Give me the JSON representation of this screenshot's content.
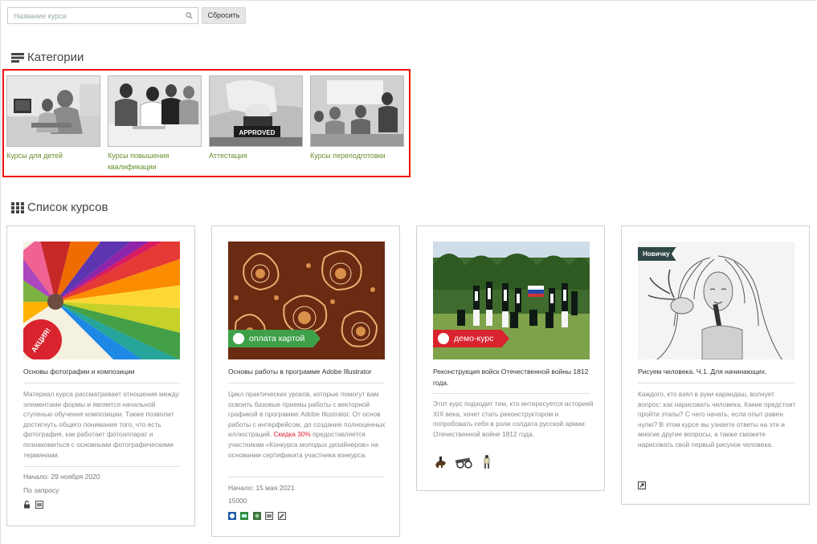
{
  "search": {
    "placeholder": "Название курса",
    "reset_label": "Сбросить"
  },
  "categories": {
    "title": "Категории",
    "items": [
      {
        "label": "Курсы для детей"
      },
      {
        "label": "Курсы повышения квалификации"
      },
      {
        "label": "Аттестация",
        "stamp": "APPROVED"
      },
      {
        "label": "Курсы переподготовки"
      }
    ]
  },
  "courses": {
    "title": "Список курсов",
    "items": [
      {
        "badge": "АКЦИЯ!",
        "title": "Основы фотографии и композиции",
        "description": "Материал курса рассматривает отношения между элементами формы и является начальной ступенью обучения композиции. Также позволит достигнуть общего понимания того, что есть фотография, как работает фотоаппарат и познакомиться с основными фотографическими терминами.",
        "start": "Начало: 29 ноября 2020",
        "price": "По запросу"
      },
      {
        "ribbon": "оплата картой",
        "title": "Основы работы в программе Adobe Illustrator",
        "description_before": "Цикл практических уроков, которые помогут вам освоить базовые приемы работы с векторной графикой в программе Adobe Illustrator. От основ работы с интерфейсом, до создания полноценных иллюстраций.",
        "discount": "Скидка 30%",
        "description_after": " предоставляется участникам «Конкурса молодых дизайнеров» на основании сертификата участника конкурса.",
        "start": "Начало: 15 мая 2021",
        "price": "15000"
      },
      {
        "ribbon": "демо-курс",
        "title": "Реконструкция войск Отечественной войны 1812 года.",
        "description": "Этот курс подходит тем, кто интересуется историей XIX века, хочет стать реконструктором и попробовать себя в роли солдата русской армии Отечественной войне 1812 года."
      },
      {
        "badge": "Новичку",
        "title": "Рисуем человека. Ч.1. Для начинающих.",
        "description": "Каждого, кто взял в руки карандаш, волнует вопрос: как нарисовать человека. Какие предстоит пройти этапы? С чего начать, если опыт равен нулю? В этом курсе вы узнаете ответы на эти и многие другие вопросы, а также сможете нарисовать свой первый рисунок человека."
      }
    ]
  },
  "colors": {
    "accent_green": "#6b8d2d",
    "ribbon_green": "#3fa04a",
    "ribbon_red": "#d9232e",
    "highlight": "#e11111"
  }
}
